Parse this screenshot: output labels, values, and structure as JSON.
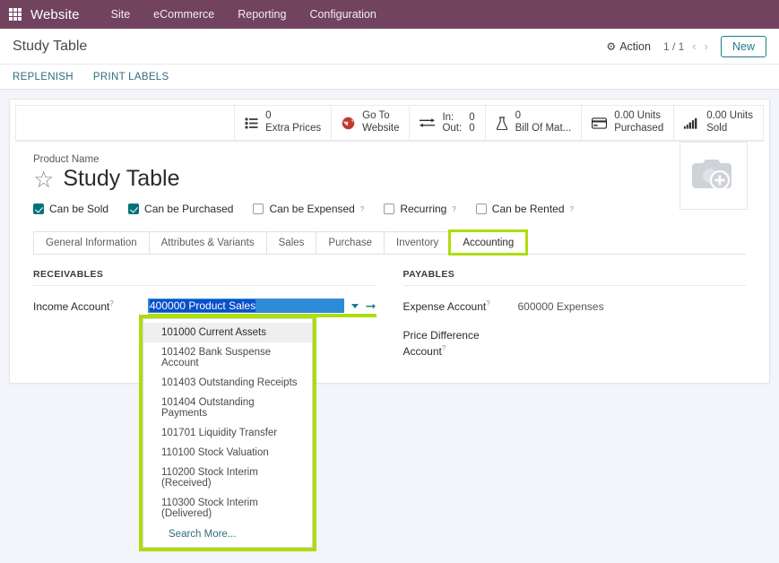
{
  "appbar": {
    "grid_icon": "apps-grid-icon",
    "app_title": "Website",
    "menu": [
      "Site",
      "eCommerce",
      "Reporting",
      "Configuration"
    ]
  },
  "control_panel": {
    "breadcrumb": "Study Table",
    "action_label": "Action",
    "gear_icon": "gear-icon",
    "pager": "1 / 1",
    "prev_icon": "chevron-left-icon",
    "next_icon": "chevron-right-icon",
    "new_label": "New"
  },
  "action_bar": {
    "buttons": [
      "REPLENISH",
      "PRINT LABELS"
    ]
  },
  "stat_buttons": [
    {
      "icon": "list-icon",
      "value": "0",
      "label": "Extra Prices"
    },
    {
      "icon": "globe-icon",
      "value": "Go To",
      "label": "Website"
    },
    {
      "icon": "exchange-icon",
      "value": "In:",
      "label": "Out:",
      "in_count": "0",
      "out_count": "0"
    },
    {
      "icon": "flask-icon",
      "value": "0",
      "label": "Bill Of Mat..."
    },
    {
      "icon": "card-icon",
      "value": "0.00 Units",
      "label": "Purchased"
    },
    {
      "icon": "bars-icon",
      "value": "0.00 Units",
      "label": "Sold"
    }
  ],
  "product": {
    "name_label": "Product Name",
    "name": "Study Table",
    "star_icon": "favorite-star-icon",
    "image_icon": "camera-add-placeholder-icon"
  },
  "checkboxes": [
    {
      "label": "Can be Sold",
      "checked": true,
      "help": false
    },
    {
      "label": "Can be Purchased",
      "checked": true,
      "help": false
    },
    {
      "label": "Can be Expensed",
      "checked": false,
      "help": true
    },
    {
      "label": "Recurring",
      "checked": false,
      "help": true
    },
    {
      "label": "Can be Rented",
      "checked": false,
      "help": true
    }
  ],
  "tabs": [
    {
      "label": "General Information",
      "active": false
    },
    {
      "label": "Attributes & Variants",
      "active": false
    },
    {
      "label": "Sales",
      "active": false
    },
    {
      "label": "Purchase",
      "active": false
    },
    {
      "label": "Inventory",
      "active": false
    },
    {
      "label": "Accounting",
      "active": true
    }
  ],
  "accounting": {
    "receivables_title": "RECEIVABLES",
    "payables_title": "PAYABLES",
    "income_account_label": "Income Account",
    "income_account_value": "400000 Product Sales",
    "income_account_placeholder": "",
    "expense_account_label": "Expense Account",
    "expense_account_value": "600000 Expenses",
    "price_difference_label_line1": "Price Difference",
    "price_difference_label_line2": "Account",
    "price_difference_value": "",
    "caret_icon": "chevron-down-icon",
    "internal_link_icon": "internal-link-arrow-icon"
  },
  "dropdown": {
    "items": [
      "101000 Current Assets",
      "101402 Bank Suspense Account",
      "101403 Outstanding Receipts",
      "101404 Outstanding Payments",
      "101701 Liquidity Transfer",
      "110100 Stock Valuation",
      "110200 Stock Interim (Received)",
      "110300 Stock Interim (Delivered)"
    ],
    "search_more": "Search More..."
  },
  "colors": {
    "appbar": "#71435f",
    "accent_teal": "#1d7b8a",
    "highlight_green": "#aedd0d",
    "selection_blue": "#2e8bd8",
    "checkbox_checked": "#00737a",
    "globe_red": "#c0392b",
    "page_bg": "#f4f5fa"
  }
}
